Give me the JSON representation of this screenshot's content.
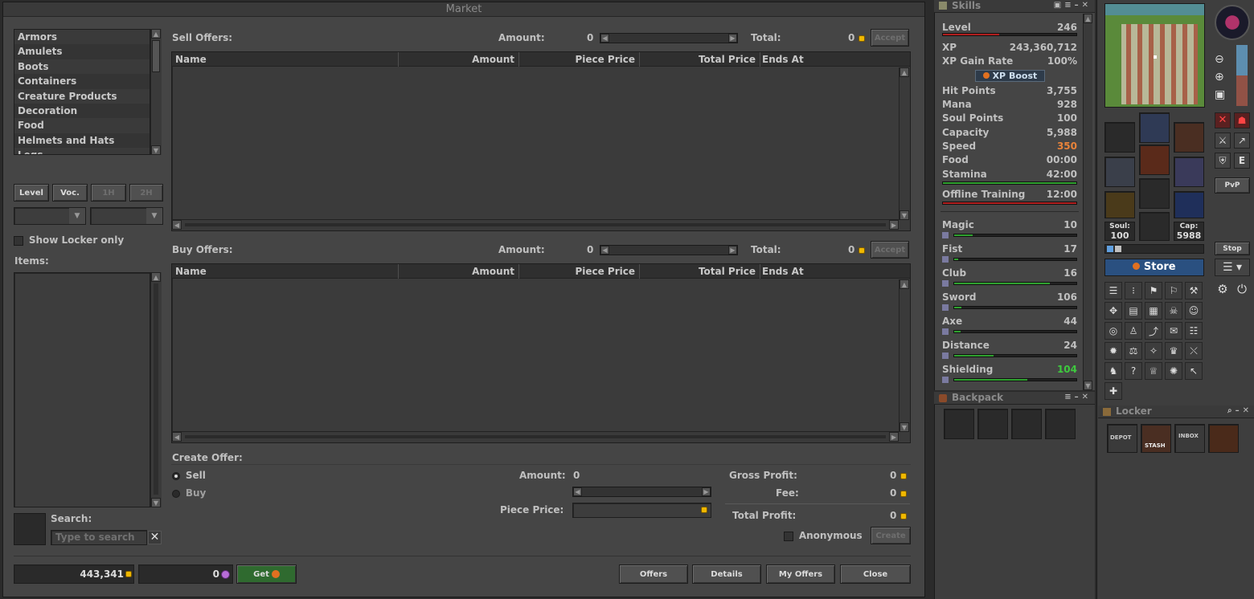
{
  "market": {
    "title": "Market",
    "categories": [
      "Armors",
      "Amulets",
      "Boots",
      "Containers",
      "Creature Products",
      "Decoration",
      "Food",
      "Helmets and Hats",
      "Legs"
    ],
    "filters": {
      "level": "Level",
      "voc": "Voc.",
      "one_hand": "1H",
      "two_hand": "2H"
    },
    "show_locker_only": "Show Locker only",
    "items_label": "Items:",
    "search_label": "Search:",
    "search_placeholder": "Type to search",
    "sell_offers": {
      "label": "Sell Offers:",
      "amount_label": "Amount:",
      "amount_value": "0",
      "total_label": "Total:",
      "total_value": "0",
      "accept": "Accept"
    },
    "buy_offers": {
      "label": "Buy Offers:",
      "amount_label": "Amount:",
      "amount_value": "0",
      "total_label": "Total:",
      "total_value": "0",
      "accept": "Accept"
    },
    "columns": [
      "Name",
      "Amount",
      "Piece Price",
      "Total Price",
      "Ends At"
    ],
    "create_offer": {
      "label": "Create Offer:",
      "sell": "Sell",
      "buy": "Buy",
      "amount_label": "Amount:",
      "amount_value": "0",
      "piece_price_label": "Piece Price:",
      "gross_profit_label": "Gross Profit:",
      "gross_profit_value": "0",
      "fee_label": "Fee:",
      "fee_value": "0",
      "total_profit_label": "Total Profit:",
      "total_profit_value": "0",
      "anonymous": "Anonymous",
      "create": "Create"
    },
    "gold_balance": "443,341",
    "coin_balance": "0",
    "get_button": "Get",
    "buttons": {
      "offers": "Offers",
      "details": "Details",
      "my_offers": "My Offers",
      "close": "Close"
    }
  },
  "skills": {
    "title": "Skills",
    "level_label": "Level",
    "level_value": "246",
    "level_progress": 0.42,
    "xp_label": "XP",
    "xp_value": "243,360,712",
    "xp_gain_label": "XP Gain Rate",
    "xp_gain_value": "100%",
    "xp_boost": "XP Boost",
    "stats": [
      {
        "label": "Hit Points",
        "value": "3,755"
      },
      {
        "label": "Mana",
        "value": "928"
      },
      {
        "label": "Soul Points",
        "value": "100"
      },
      {
        "label": "Capacity",
        "value": "5,988"
      },
      {
        "label": "Speed",
        "value": "350"
      },
      {
        "label": "Food",
        "value": "00:00"
      },
      {
        "label": "Stamina",
        "value": "42:00"
      }
    ],
    "stamina_progress": 1.0,
    "offline_training_label": "Offline Training",
    "offline_training_value": "12:00",
    "offline_progress": 1.0,
    "skill_list": [
      {
        "label": "Magic",
        "value": "10",
        "progress": 0.15
      },
      {
        "label": "Fist",
        "value": "17",
        "progress": 0.03
      },
      {
        "label": "Club",
        "value": "16",
        "progress": 0.78
      },
      {
        "label": "Sword",
        "value": "106",
        "progress": 0.06
      },
      {
        "label": "Axe",
        "value": "44",
        "progress": 0.05
      },
      {
        "label": "Distance",
        "value": "24",
        "progress": 0.32
      },
      {
        "label": "Shielding",
        "value": "104",
        "progress": 0.6
      }
    ],
    "colors": {
      "speed": "#e8833a",
      "shielding": "#3ec93e",
      "bar_green": "#2fa12f",
      "bar_red": "#b01e1e"
    }
  },
  "equipment": {
    "soul_label": "Soul:",
    "soul_value": "100",
    "cap_label": "Cap:",
    "cap_value": "5988"
  },
  "store_button": "Store",
  "stop_button": "Stop",
  "pvp_button": "PvP",
  "e_button": "E",
  "backpack": {
    "title": "Backpack"
  },
  "locker": {
    "title": "Locker",
    "items": [
      "DEPOT",
      "STASH",
      "INBOX",
      "item"
    ]
  }
}
